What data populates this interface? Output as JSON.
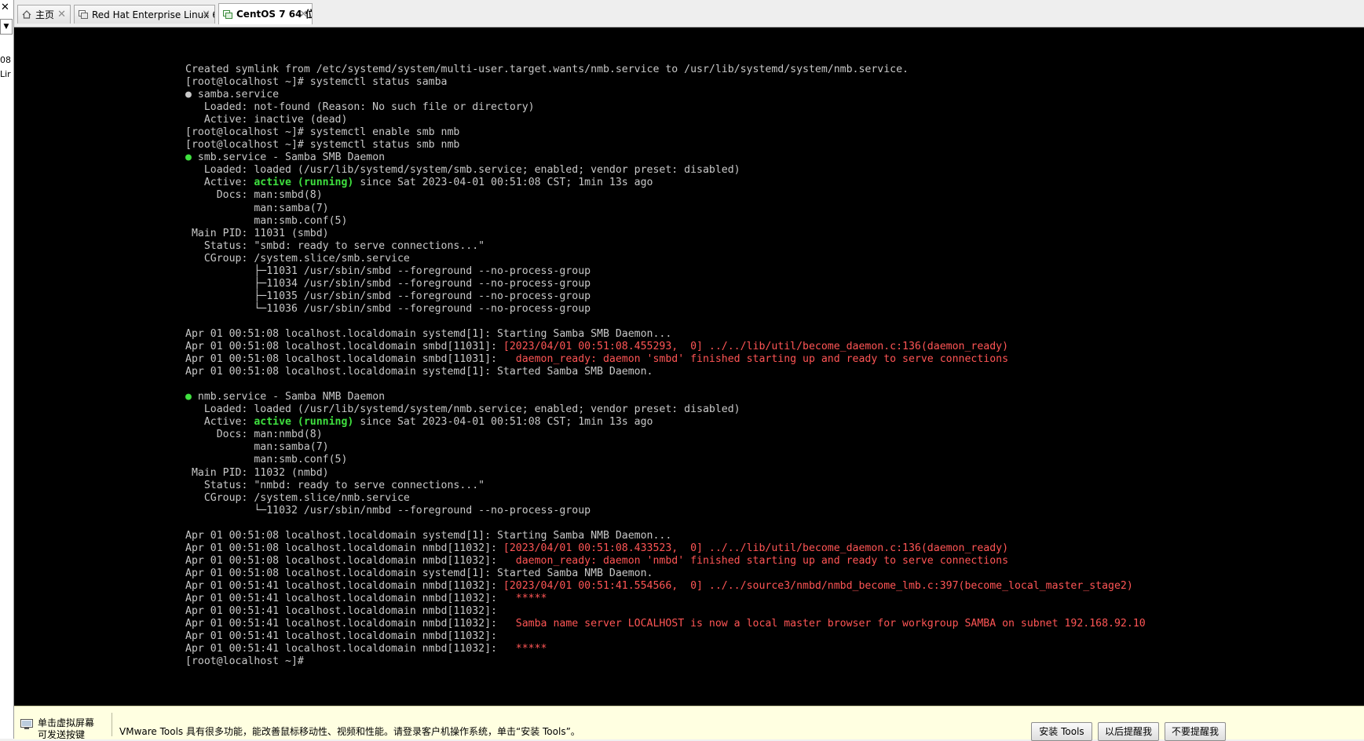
{
  "left_strip": {
    "close_glyph": "✕",
    "frag1": "08",
    "frag2": "Lir"
  },
  "tabs": [
    {
      "label": "主页",
      "icon": "home-icon",
      "close": "✕",
      "active": false
    },
    {
      "label": "Red Hat Enterprise Linux 6 客...",
      "icon": "vm-icon",
      "close": "✕",
      "active": false
    },
    {
      "label": "CentOS 7 64 位",
      "icon": "vm-icon",
      "close": "✕",
      "active": true
    }
  ],
  "terminal": {
    "lines": [
      [
        {
          "t": "Created symlink from /etc/systemd/system/multi-user.target.wants/nmb.service to /usr/lib/systemd/system/nmb.service."
        }
      ],
      [
        {
          "t": "[root@localhost ~]# systemctl status samba"
        }
      ],
      [
        {
          "t": "● samba.service"
        }
      ],
      [
        {
          "t": "   Loaded: not-found (Reason: No such file or directory)"
        }
      ],
      [
        {
          "t": "   Active: inactive (dead)"
        }
      ],
      [
        {
          "t": "[root@localhost ~]# systemctl enable smb nmb"
        }
      ],
      [
        {
          "t": "[root@localhost ~]# systemctl status smb nmb"
        }
      ],
      [
        {
          "t": "●",
          "c": "g"
        },
        {
          "t": " smb.service - Samba SMB Daemon"
        }
      ],
      [
        {
          "t": "   Loaded: loaded (/usr/lib/systemd/system/smb.service; enabled; vendor preset: disabled)"
        }
      ],
      [
        {
          "t": "   Active: "
        },
        {
          "t": "active (running)",
          "c": "g"
        },
        {
          "t": " since Sat 2023-04-01 00:51:08 CST; 1min 13s ago"
        }
      ],
      [
        {
          "t": "     Docs: man:smbd(8)"
        }
      ],
      [
        {
          "t": "           man:samba(7)"
        }
      ],
      [
        {
          "t": "           man:smb.conf(5)"
        }
      ],
      [
        {
          "t": " Main PID: 11031 (smbd)"
        }
      ],
      [
        {
          "t": "   Status: \"smbd: ready to serve connections...\""
        }
      ],
      [
        {
          "t": "   CGroup: /system.slice/smb.service"
        }
      ],
      [
        {
          "t": "           ├─11031 /usr/sbin/smbd --foreground --no-process-group"
        }
      ],
      [
        {
          "t": "           ├─11034 /usr/sbin/smbd --foreground --no-process-group"
        }
      ],
      [
        {
          "t": "           ├─11035 /usr/sbin/smbd --foreground --no-process-group"
        }
      ],
      [
        {
          "t": "           └─11036 /usr/sbin/smbd --foreground --no-process-group"
        }
      ],
      [
        {
          "t": ""
        }
      ],
      [
        {
          "t": "Apr 01 00:51:08 localhost.localdomain systemd[1]: Starting Samba SMB Daemon..."
        }
      ],
      [
        {
          "t": "Apr 01 00:51:08 localhost.localdomain smbd[11031]: "
        },
        {
          "t": "[2023/04/01 00:51:08.455293,  0] ../../lib/util/become_daemon.c:136(daemon_ready)",
          "c": "r"
        }
      ],
      [
        {
          "t": "Apr 01 00:51:08 localhost.localdomain smbd[11031]: "
        },
        {
          "t": "  daemon_ready: daemon 'smbd' finished starting up and ready to serve connections",
          "c": "r"
        }
      ],
      [
        {
          "t": "Apr 01 00:51:08 localhost.localdomain systemd[1]: Started Samba SMB Daemon."
        }
      ],
      [
        {
          "t": ""
        }
      ],
      [
        {
          "t": "●",
          "c": "g"
        },
        {
          "t": " nmb.service - Samba NMB Daemon"
        }
      ],
      [
        {
          "t": "   Loaded: loaded (/usr/lib/systemd/system/nmb.service; enabled; vendor preset: disabled)"
        }
      ],
      [
        {
          "t": "   Active: "
        },
        {
          "t": "active (running)",
          "c": "g"
        },
        {
          "t": " since Sat 2023-04-01 00:51:08 CST; 1min 13s ago"
        }
      ],
      [
        {
          "t": "     Docs: man:nmbd(8)"
        }
      ],
      [
        {
          "t": "           man:samba(7)"
        }
      ],
      [
        {
          "t": "           man:smb.conf(5)"
        }
      ],
      [
        {
          "t": " Main PID: 11032 (nmbd)"
        }
      ],
      [
        {
          "t": "   Status: \"nmbd: ready to serve connections...\""
        }
      ],
      [
        {
          "t": "   CGroup: /system.slice/nmb.service"
        }
      ],
      [
        {
          "t": "           └─11032 /usr/sbin/nmbd --foreground --no-process-group"
        }
      ],
      [
        {
          "t": ""
        }
      ],
      [
        {
          "t": "Apr 01 00:51:08 localhost.localdomain systemd[1]: Starting Samba NMB Daemon..."
        }
      ],
      [
        {
          "t": "Apr 01 00:51:08 localhost.localdomain nmbd[11032]: "
        },
        {
          "t": "[2023/04/01 00:51:08.433523,  0] ../../lib/util/become_daemon.c:136(daemon_ready)",
          "c": "r"
        }
      ],
      [
        {
          "t": "Apr 01 00:51:08 localhost.localdomain nmbd[11032]: "
        },
        {
          "t": "  daemon_ready: daemon 'nmbd' finished starting up and ready to serve connections",
          "c": "r"
        }
      ],
      [
        {
          "t": "Apr 01 00:51:08 localhost.localdomain systemd[1]: Started Samba NMB Daemon."
        }
      ],
      [
        {
          "t": "Apr 01 00:51:41 localhost.localdomain nmbd[11032]: "
        },
        {
          "t": "[2023/04/01 00:51:41.554566,  0] ../../source3/nmbd/nmbd_become_lmb.c:397(become_local_master_stage2)",
          "c": "r"
        }
      ],
      [
        {
          "t": "Apr 01 00:51:41 localhost.localdomain nmbd[11032]: "
        },
        {
          "t": "  *****",
          "c": "r"
        }
      ],
      [
        {
          "t": "Apr 01 00:51:41 localhost.localdomain nmbd[11032]: "
        }
      ],
      [
        {
          "t": "Apr 01 00:51:41 localhost.localdomain nmbd[11032]: "
        },
        {
          "t": "  Samba name server LOCALHOST is now a local master browser for workgroup SAMBA on subnet 192.168.92.10",
          "c": "r"
        }
      ],
      [
        {
          "t": "Apr 01 00:51:41 localhost.localdomain nmbd[11032]: "
        }
      ],
      [
        {
          "t": "Apr 01 00:51:41 localhost.localdomain nmbd[11032]: "
        },
        {
          "t": "  *****",
          "c": "r"
        }
      ],
      [
        {
          "t": "[root@localhost ~]#"
        }
      ]
    ]
  },
  "notification": {
    "icon": "screen-icon",
    "click_hint_line1": "单击虚拟屏幕",
    "click_hint_line2": "可发送按键",
    "message": "VMware Tools 具有很多功能，能改善鼠标移动性、视频和性能。请登录客户机操作系统，单击“安装 Tools”。",
    "install_button": "安装 Tools",
    "remind_later_button": "以后提醒我",
    "dont_remind_button": "不要提醒我"
  },
  "colors": {
    "console_bg": "#000000",
    "console_text": "#c8c8c8",
    "active_green": "#3fe03f",
    "log_red": "#ff5555",
    "notify_bg": "#ffffe1"
  }
}
